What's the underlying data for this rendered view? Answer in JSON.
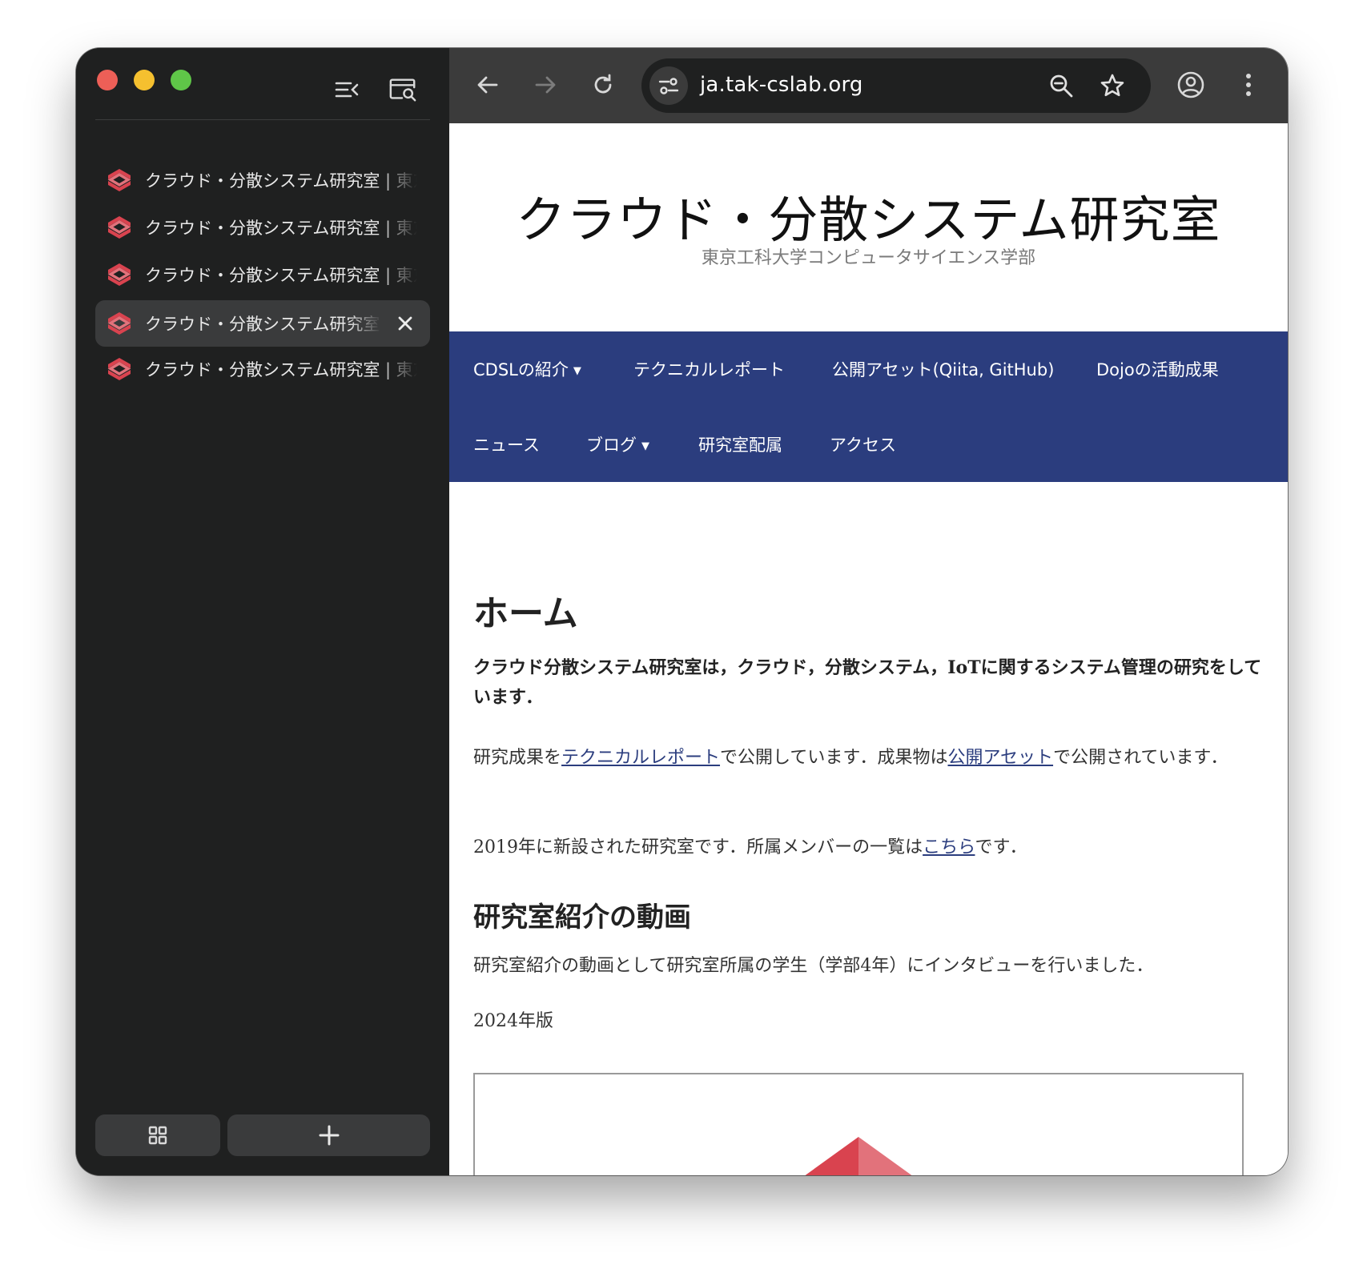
{
  "sidebar": {
    "tabs": [
      {
        "title": "クラウド・分散システム研究室 | 東京工科大学コンピュータサイエンス学部",
        "active": false
      },
      {
        "title": "クラウド・分散システム研究室 | 東京工科大学コンピュータサイエンス学部",
        "active": false
      },
      {
        "title": "クラウド・分散システム研究室 | 東京工科大学コンピュータサイエンス学部",
        "active": false
      },
      {
        "title": "クラウド・分散システム研究室 | 東京工科大学コンピュータサイエンス学部",
        "active": true
      },
      {
        "title": "クラウド・分散システム研究室 | 東京工科大学コンピュータサイエンス学部",
        "active": false
      }
    ],
    "close_glyph": "✕",
    "bottom_buttons": {
      "grid_icon": "grid-icon",
      "new_tab_icon": "plus-icon"
    }
  },
  "toolbar": {
    "url": "ja.tak-cslab.org",
    "icons": [
      "back-arrow-icon",
      "forward-arrow-icon",
      "reload-icon",
      "site-settings-icon",
      "zoom-icon",
      "bookmark-star-icon",
      "profile-icon",
      "more-menu-icon"
    ]
  },
  "site": {
    "title": "クラウド・分散システム研究室",
    "subtitle": "東京工科大学コンピュータサイエンス学部",
    "nav": [
      {
        "label": "CDSLの紹介",
        "caret": "▼"
      },
      {
        "label": "テクニカルレポート",
        "caret": ""
      },
      {
        "label": "公開アセット(Qiita, GitHub)",
        "caret": ""
      },
      {
        "label": "Dojoの活動成果",
        "caret": ""
      },
      {
        "label": "ニュース",
        "caret": ""
      },
      {
        "label": "ブログ",
        "caret": "▼"
      },
      {
        "label": "研究室配属",
        "caret": ""
      },
      {
        "label": "アクセス",
        "caret": ""
      }
    ]
  },
  "page": {
    "heading": "ホーム",
    "lead": "クラウド分散システム研究室は，クラウド，分散システム，IoTに関するシステム管理の研究をしています．",
    "p1_a": "研究成果を",
    "p1_link1": "テクニカルレポート",
    "p1_b": "で公開しています．成果物は",
    "p1_link2": "公開アセット",
    "p1_c": "で公開されています．",
    "p2_a": "2019年に新設された研究室です．所属メンバーの一覧は",
    "p2_link": "こちら",
    "p2_b": "です．",
    "heading2": "研究室紹介の動画",
    "p3": "研究室紹介の動画として研究室所属の学生（学部4年）にインタビューを行いました．",
    "p4": "2024年版"
  },
  "colors": {
    "nav_bg": "#2b3d7e",
    "logo_red": "#d9434f",
    "logo_pink": "#e2727b",
    "sidebar_bg": "#1f2020",
    "toolbar_bg": "#3b3b3b"
  }
}
